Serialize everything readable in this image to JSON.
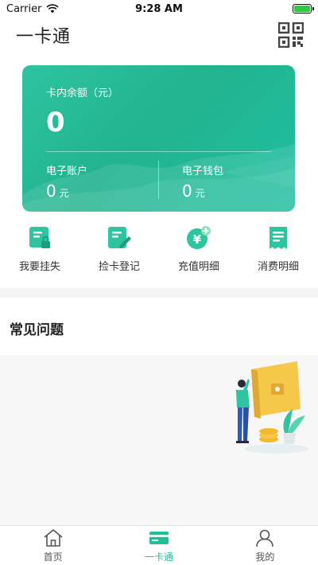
{
  "status_bar": {
    "carrier": "Carrier",
    "time": "9:28 AM"
  },
  "nav": {
    "title": "一卡通",
    "qr_icon": "qr-code-icon"
  },
  "card": {
    "balance_label": "卡内余额（元）",
    "balance_value": "0",
    "electronic_account_label": "电子账户",
    "electronic_account_value": "0",
    "electronic_wallet_label": "电子钱包",
    "electronic_wallet_value": "0",
    "unit": "元"
  },
  "actions": [
    {
      "label": "我要挂失",
      "icon": "report-loss-icon"
    },
    {
      "label": "捡卡登记",
      "icon": "found-card-register-icon"
    },
    {
      "label": "充值明细",
      "icon": "recharge-detail-icon"
    },
    {
      "label": "消费明细",
      "icon": "consumption-detail-icon"
    }
  ],
  "faq": {
    "title": "常见问题"
  },
  "tabs": [
    {
      "label": "首页",
      "icon": "home-icon"
    },
    {
      "label": "一卡通",
      "icon": "card-icon"
    },
    {
      "label": "我的",
      "icon": "profile-icon"
    }
  ],
  "colors": {
    "accent": "#1fbf9a",
    "card_start": "#2ec4a0",
    "card_end": "#1fbfa0"
  }
}
